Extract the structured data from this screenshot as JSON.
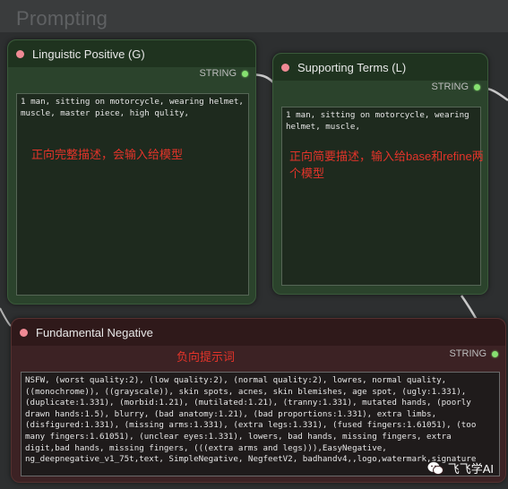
{
  "group": {
    "title": "Prompting"
  },
  "nodes": {
    "linguistic_positive": {
      "title": "Linguistic Positive (G)",
      "output_label": "STRING",
      "text": "1 man, sitting on motorcycle, wearing helmet, muscle, master piece, high qulity,",
      "annotation": "正向完整描述，会输入给模型"
    },
    "supporting_terms": {
      "title": "Supporting Terms (L)",
      "output_label": "STRING",
      "text": "1 man, sitting on motorcycle, wearing helmet, muscle,",
      "annotation": "正向简要描述，输入给base和refine两个模型"
    },
    "fundamental_negative": {
      "title": "Fundamental Negative",
      "output_label": "STRING",
      "annotation": "负向提示词",
      "text": "NSFW, (worst quality:2), (low quality:2), (normal quality:2), lowres, normal quality, ((monochrome)), ((grayscale)), skin spots, acnes, skin blemishes, age spot, (ugly:1.331), (duplicate:1.331), (morbid:1.21), (mutilated:1.21), (tranny:1.331), mutated hands, (poorly drawn hands:1.5), blurry, (bad anatomy:1.21), (bad proportions:1.331), extra limbs, (disfigured:1.331), (missing arms:1.331), (extra legs:1.331), (fused fingers:1.61051), (too many fingers:1.61051), (unclear eyes:1.331), lowers, bad hands, missing fingers, extra digit,bad hands, missing fingers, (((extra arms and legs))),EasyNegative, ng_deepnegative_v1_75t,text, SimpleNegative, NegfeetV2, badhandv4,,logo,watermark,signature"
    }
  },
  "watermark": {
    "text": "飞飞学AI"
  },
  "colors": {
    "input_dot": "#f08a95",
    "output_dot": "#86e070",
    "annotation": "#e3342a"
  }
}
